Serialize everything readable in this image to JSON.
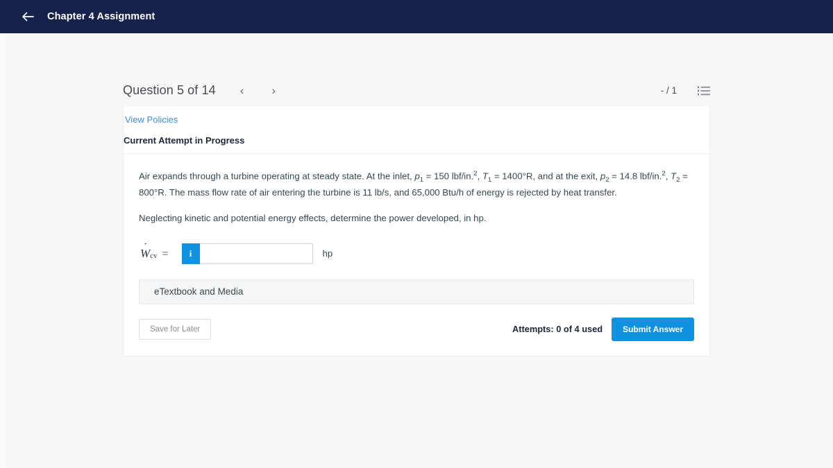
{
  "topbar": {
    "back_icon": "arrow-left-icon",
    "title": "Chapter 4 Assignment"
  },
  "question_header": {
    "counter": "Question 5 of 14",
    "prev_label": "‹",
    "next_label": "›",
    "score": "- / 1",
    "list_icon": "list-icon"
  },
  "card": {
    "view_policies": "View Policies",
    "attempt_status": "Current Attempt in Progress",
    "question": {
      "para1_part1": "Air expands through a turbine operating at steady state. At the inlet, ",
      "p1_symbol": "p",
      "p1_sub": "1",
      "part2": " = 150 lbf/in.",
      "sup2_a": "2",
      "part3": ", ",
      "T1_symbol": "T",
      "T1_sub": "1",
      "part4": " = 1400°R, and at the exit, ",
      "p2_symbol": "p",
      "p2_sub": "2",
      "part5": " = 14.8 lbf/in.",
      "sup2_b": "2",
      "part6": ", ",
      "T2_symbol": "T",
      "T2_sub": "2",
      "part7": " = 800°R. The mass flow rate of air entering the turbine is 11 lb/s, and 65,000 Btu/h of energy is rejected by heat transfer.",
      "para2": "Neglecting kinetic and potential energy effects, determine the power developed, in hp."
    },
    "answer": {
      "symbol_main": "W",
      "symbol_sub": "cv",
      "equals": "=",
      "info_button_label": "i",
      "input_value": "",
      "input_placeholder": "",
      "unit": "hp"
    },
    "etextbook_label": "eTextbook and Media",
    "save_for_later": "Save for Later",
    "attempts": "Attempts: 0 of 4 used",
    "submit_answer": "Submit Answer"
  },
  "colors": {
    "topbar_navy": "#15224a",
    "accent_blue": "#1192e0",
    "link_blue": "#3c8fd8",
    "page_background": "#f7f7f8",
    "card_background": "#ffffff"
  }
}
